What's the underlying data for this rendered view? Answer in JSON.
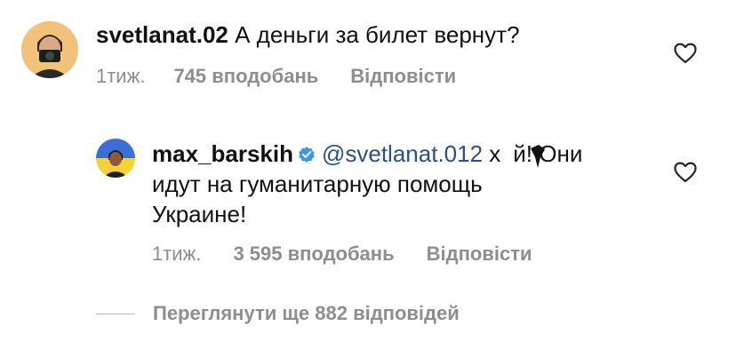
{
  "comments": [
    {
      "username": "svetlanat.02",
      "text": "А деньги за билет вернут?",
      "time": "1тиж.",
      "likes": "745 вподобань",
      "reply_label": "Відповісти",
      "avatar_icon": "person-with-camera-avatar",
      "like_icon": "heart-icon"
    },
    {
      "username": "max_barskih",
      "verified": true,
      "mention": "@svetlanat.012",
      "text_part1": "х",
      "text_part2": "й! Они",
      "text_line2": "идут на гуманитарную помощь",
      "text_line3": "Украине!",
      "time": "1тиж.",
      "likes": "3 595 вподобань",
      "reply_label": "Відповісти",
      "avatar_icon": "person-avatar-ukraine-flag",
      "like_icon": "heart-icon"
    }
  ],
  "view_replies": "Переглянути ще 882 відповідей",
  "colors": {
    "text": "#111111",
    "secondary": "#8e8e8e",
    "mention": "#2b4f86",
    "verified": "#3897f0"
  }
}
